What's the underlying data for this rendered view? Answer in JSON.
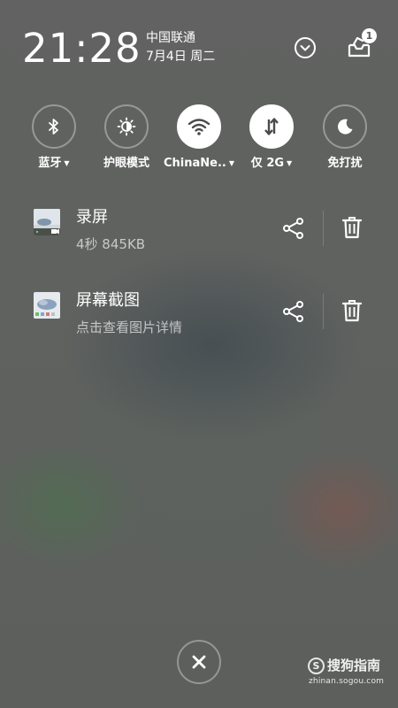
{
  "status": {
    "time": "21:28",
    "carrier": "中国联通",
    "date": "7月4日 周二",
    "notification_count": "1"
  },
  "toggles": [
    {
      "label": "蓝牙",
      "icon": "bluetooth-icon",
      "active": false,
      "has_menu": true
    },
    {
      "label": "护眼模式",
      "icon": "eye-comfort-icon",
      "active": false,
      "has_menu": false
    },
    {
      "label": "ChinaNe..",
      "icon": "wifi-icon",
      "active": true,
      "has_menu": true
    },
    {
      "label": "仅 2G",
      "icon": "mobile-data-icon",
      "active": true,
      "has_menu": true
    },
    {
      "label": "免打扰",
      "icon": "moon-icon",
      "active": false,
      "has_menu": false
    }
  ],
  "notifications": [
    {
      "title": "录屏",
      "subtitle": "4秒  845KB",
      "thumb": "screen-recording-thumbnail"
    },
    {
      "title": "屏幕截图",
      "subtitle": "点击查看图片详情",
      "thumb": "screenshot-thumbnail"
    }
  ],
  "watermark": {
    "logo": "S",
    "brand": "搜狗指南",
    "url": "zhinan.sogou.com"
  },
  "colors": {
    "icon_on_active": "#4a4a4a",
    "icon_white": "#ffffff"
  }
}
